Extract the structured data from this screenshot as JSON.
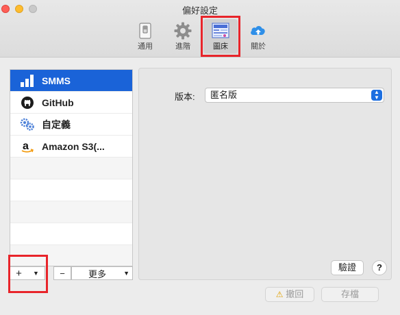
{
  "window": {
    "title": "偏好設定"
  },
  "toolbar": {
    "items": [
      {
        "label": "通用",
        "icon": "switch-icon"
      },
      {
        "label": "進階",
        "icon": "gear-icon"
      },
      {
        "label": "圖床",
        "icon": "image-host-icon"
      },
      {
        "label": "關於",
        "icon": "cloud-upload-icon"
      }
    ],
    "active_index": 2
  },
  "sidebar": {
    "items": [
      {
        "label": "SMMS",
        "icon": "bar-chart-icon",
        "selected": true
      },
      {
        "label": "GitHub",
        "icon": "github-icon"
      },
      {
        "label": "自定義",
        "icon": "gears-icon"
      },
      {
        "label": "Amazon S3(...",
        "icon": "amazon-icon"
      }
    ],
    "add_label": "+",
    "remove_label": "−",
    "more_label": "更多"
  },
  "panel": {
    "version_label": "版本:",
    "version_value": "匿名版",
    "verify_label": "驗證",
    "help_label": "?"
  },
  "footer": {
    "revert_label": "撤回",
    "save_label": "存檔"
  },
  "colors": {
    "accent": "#1a63d8",
    "highlight_box": "#e8242a"
  }
}
